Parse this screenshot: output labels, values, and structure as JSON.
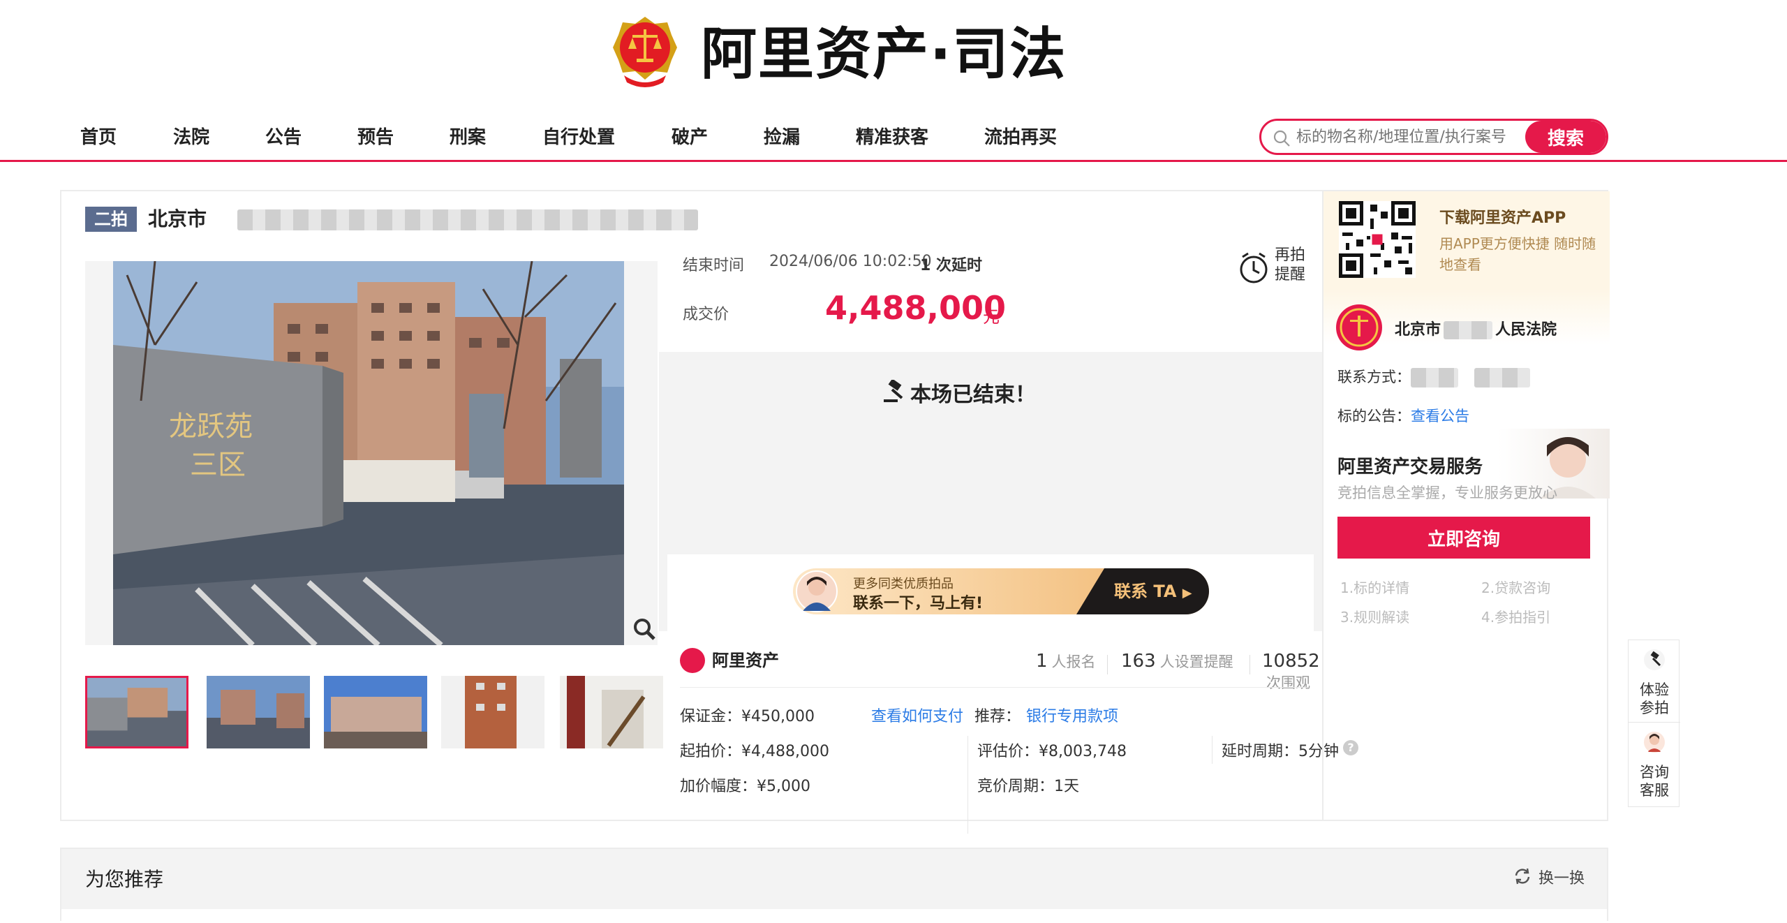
{
  "header": {
    "logo_text": "阿里资产·司法",
    "nav": [
      "首页",
      "法院",
      "公告",
      "预告",
      "刑案",
      "自行处置",
      "破产",
      "捡漏",
      "精准获客",
      "流拍再买"
    ],
    "search_placeholder": "标的物名称/地理位置/执行案号",
    "search_button": "搜索"
  },
  "item": {
    "tag": "二拍",
    "title_prefix": "北京市"
  },
  "auction": {
    "end_time_label": "结束时间",
    "end_time": "2024/06/06 10:02:50",
    "delay_count": "1 次延时",
    "alarm_label_1": "再拍",
    "alarm_label_2": "提醒",
    "deal_label": "成交价",
    "deal_price": "4,488,000",
    "deal_unit": "元",
    "ended_text": "本场已结束！"
  },
  "promo": {
    "line1": "更多同类优质拍品",
    "line2": "联系一下，马上有!",
    "button": "联系 TA"
  },
  "stats": {
    "brand": "阿里资产",
    "signup_num": "1",
    "signup_label": "人报名",
    "remind_num": "163",
    "remind_label": "人设置提醒",
    "view_num": "10852",
    "view_label": "次围观"
  },
  "details": {
    "deposit": "保证金：¥450,000",
    "how_to_pay": "查看如何支付",
    "recommend_label": "推荐：",
    "recommend_link": "银行专用款项",
    "start_price": "起拍价：¥4,488,000",
    "eval_price": "评估价：¥8,003,748",
    "delay_period": "延时周期：5分钟",
    "increment": "加价幅度：¥5,000",
    "bid_period": "竞价周期：1天"
  },
  "sidebar": {
    "app_title": "下载阿里资产APP",
    "app_sub": "用APP更方便快捷 随时随地查看",
    "court_prefix": "北京市",
    "court_suffix": "人民法院",
    "contact_label": "联系方式：",
    "notice_label": "标的公告：",
    "notice_link": "查看公告",
    "service_title": "阿里资产交易服务",
    "service_sub": "竞拍信息全掌握，专业服务更放心",
    "consult_button": "立即咨询",
    "service_items": [
      "1.标的详情",
      "2.贷款咨询",
      "3.规则解读",
      "4.参拍指引"
    ]
  },
  "float": {
    "item1": "体验参拍",
    "item2": "咨询客服"
  },
  "recommend": {
    "title": "为您推荐",
    "refresh": "换一换"
  },
  "colors": {
    "accent": "#e5194a",
    "tag_bg": "#5b6c8f",
    "link": "#2c7ce6"
  }
}
